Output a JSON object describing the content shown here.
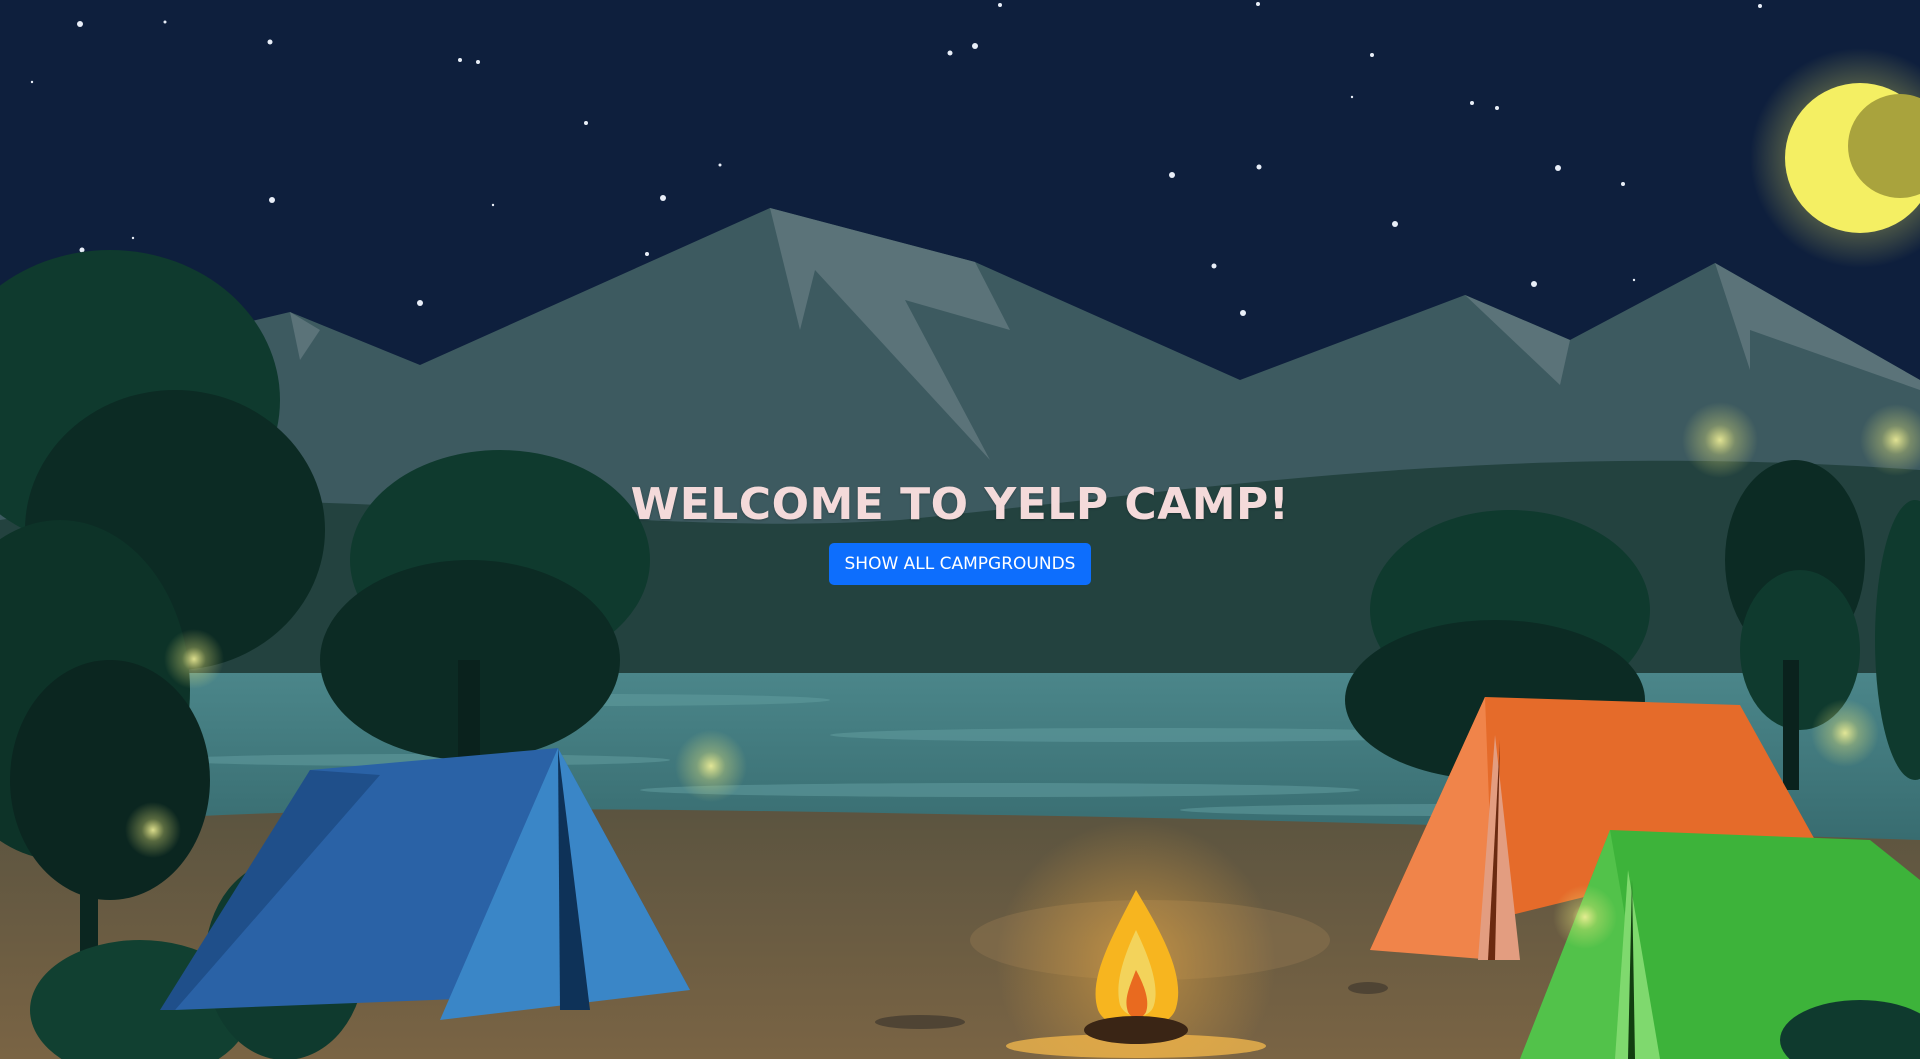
{
  "hero": {
    "title": "WELCOME TO YELP CAMP!",
    "button_label": "SHOW ALL CAMPGROUNDS"
  },
  "colors": {
    "sky": "#0e1f3d",
    "mountains": "#3d5a60",
    "lake": "#3f7a80",
    "ground": "#6d5a3e",
    "title_text": "#f4dada",
    "button_bg": "#0d6efd",
    "moon": "#f4ef63",
    "tent_blue": "#2a62a6",
    "tent_orange": "#e56b2a",
    "tent_green": "#3db33a",
    "fire": "#f7b51f"
  },
  "scene": {
    "icons": [
      "moon-icon",
      "star-icon",
      "mountain-illustration",
      "tree-illustration",
      "tent-icon",
      "campfire-icon",
      "firefly-icon"
    ]
  }
}
